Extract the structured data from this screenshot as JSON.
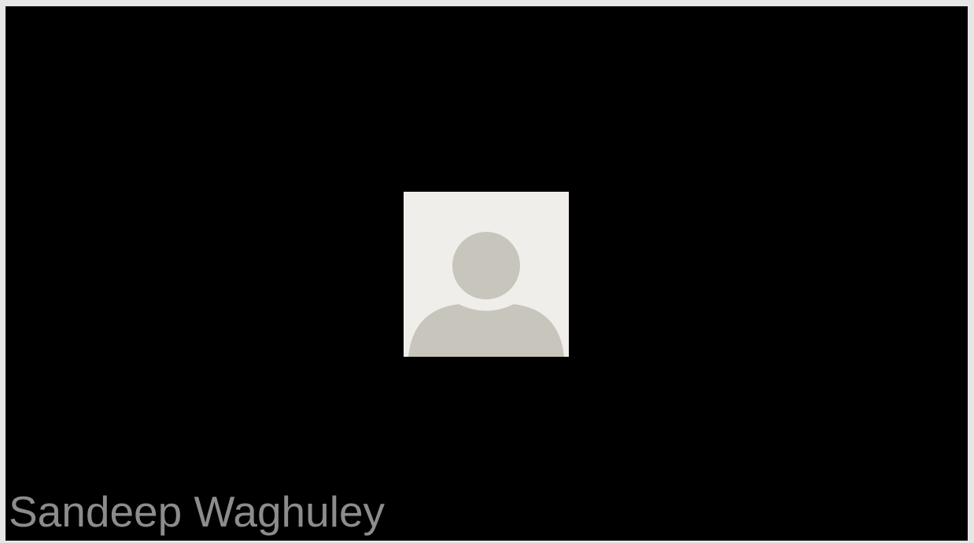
{
  "participant": {
    "name": "Sandeep Waghuley",
    "avatar_icon": "default-user-icon"
  },
  "colors": {
    "tile_background": "#000000",
    "frame_border": "#e6e6e6",
    "avatar_background": "#f0eeea",
    "avatar_silhouette": "#c8c5bc",
    "name_text": "#8c8c8c"
  }
}
